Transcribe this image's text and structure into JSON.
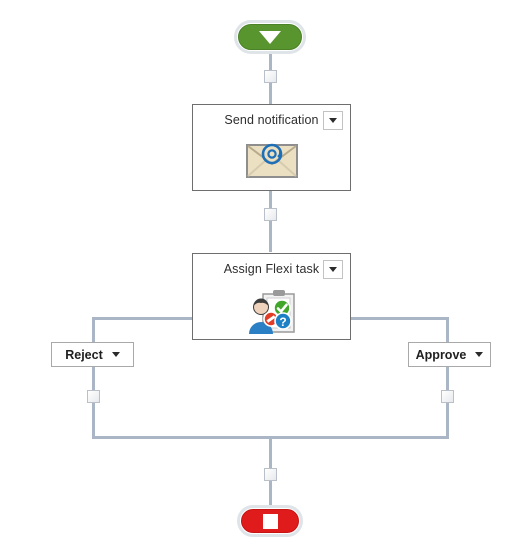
{
  "diagram": {
    "type": "workflow-designer",
    "background_color": "#ffffff",
    "connector_color": "#aab6c6"
  },
  "start_node": {
    "name": "start",
    "glyph": "triangle-down-icon",
    "color": "#58952f",
    "ring_color": "#dfe4e9"
  },
  "stop_node": {
    "name": "stop",
    "glyph": "square-stop-icon",
    "color": "#e01b1b",
    "ring_color": "#dfe4e9"
  },
  "activities": [
    {
      "id": "send-notification",
      "title": "Send notification",
      "icon": "email-envelope-icon",
      "dropdown": "chevron-down-icon"
    },
    {
      "id": "assign-flexi-task",
      "title": "Assign Flexi task",
      "icon": "assign-task-clipboard-icon",
      "dropdown": "chevron-down-icon"
    }
  ],
  "branches": [
    {
      "id": "reject",
      "label": "Reject",
      "dropdown": "chevron-down-icon"
    },
    {
      "id": "approve",
      "label": "Approve",
      "dropdown": "chevron-down-icon"
    }
  ]
}
